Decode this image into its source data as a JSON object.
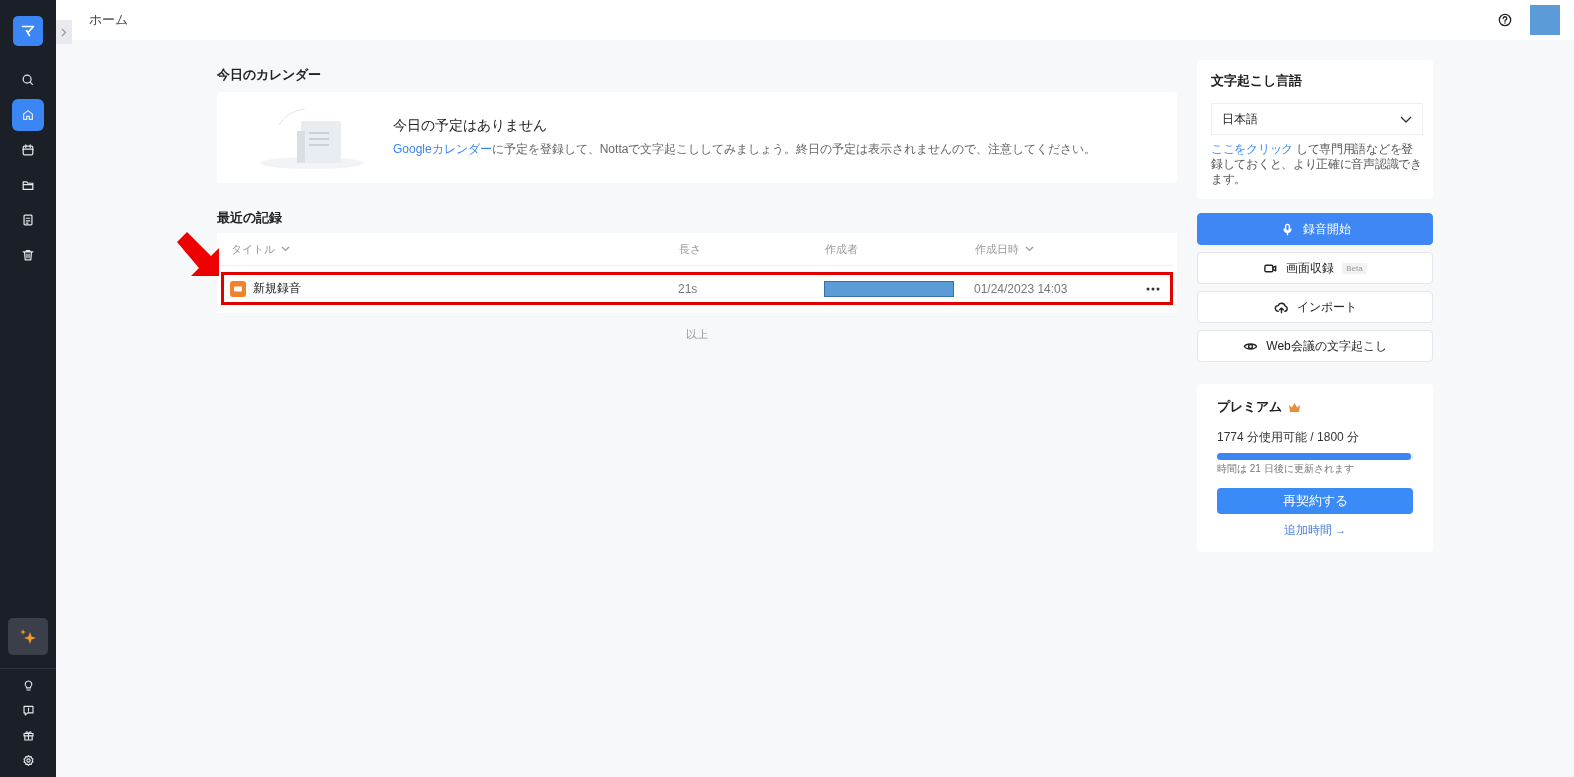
{
  "sidebar": {
    "items": [
      {
        "kind": "search",
        "selected": false
      },
      {
        "kind": "home",
        "selected": true
      },
      {
        "kind": "calendar",
        "selected": false
      },
      {
        "kind": "folder",
        "selected": false
      },
      {
        "kind": "notebook",
        "selected": false
      },
      {
        "kind": "trash",
        "selected": false
      }
    ],
    "bottom_items": [
      {
        "kind": "sparkle"
      },
      {
        "kind": "bulb"
      },
      {
        "kind": "feedback"
      },
      {
        "kind": "gift"
      },
      {
        "kind": "settings"
      }
    ]
  },
  "breadcrumb": "ホーム",
  "calendar": {
    "heading": "今日のカレンダー",
    "title": "今日の予定はありません",
    "link": "Googleカレンダー",
    "text": "に予定を登録して、Nottaで文字起こししてみましょう。終日の予定は表示されませんので、注意してください。"
  },
  "records": {
    "heading": "最近の記録",
    "columns": [
      {
        "label": "タイトル",
        "sortable": true
      },
      {
        "label": "長さ",
        "sortable": false
      },
      {
        "label": "作成者",
        "sortable": false
      },
      {
        "label": "作成日時",
        "sortable": true
      }
    ],
    "rows": [
      {
        "title": "新規録音",
        "length": "21s",
        "created": "01/24/2023 14:03",
        "highlighted": true
      }
    ],
    "footer": "以上"
  },
  "language": {
    "heading": "文字起こし言語",
    "value": "日本語",
    "link": "ここをクリック",
    "text": " して専門用語などを登録しておくと、より正確に音声認識できます。"
  },
  "actions": [
    {
      "kind": "record",
      "label": "録音開始",
      "primary": true
    },
    {
      "kind": "screen",
      "label": "画面収録",
      "badge": "Beta",
      "primary": false
    },
    {
      "kind": "import",
      "label": "インポート",
      "primary": false
    },
    {
      "kind": "meeting",
      "label": "Web会議の文字起こし",
      "primary": false
    }
  ],
  "premium": {
    "heading": "プレミアム",
    "usage": "1774 分使用可能 / 1800 分",
    "level": 0.99,
    "note": "時間は 21 日後に更新されます",
    "button": "再契約する",
    "link": "追加時間 →"
  }
}
